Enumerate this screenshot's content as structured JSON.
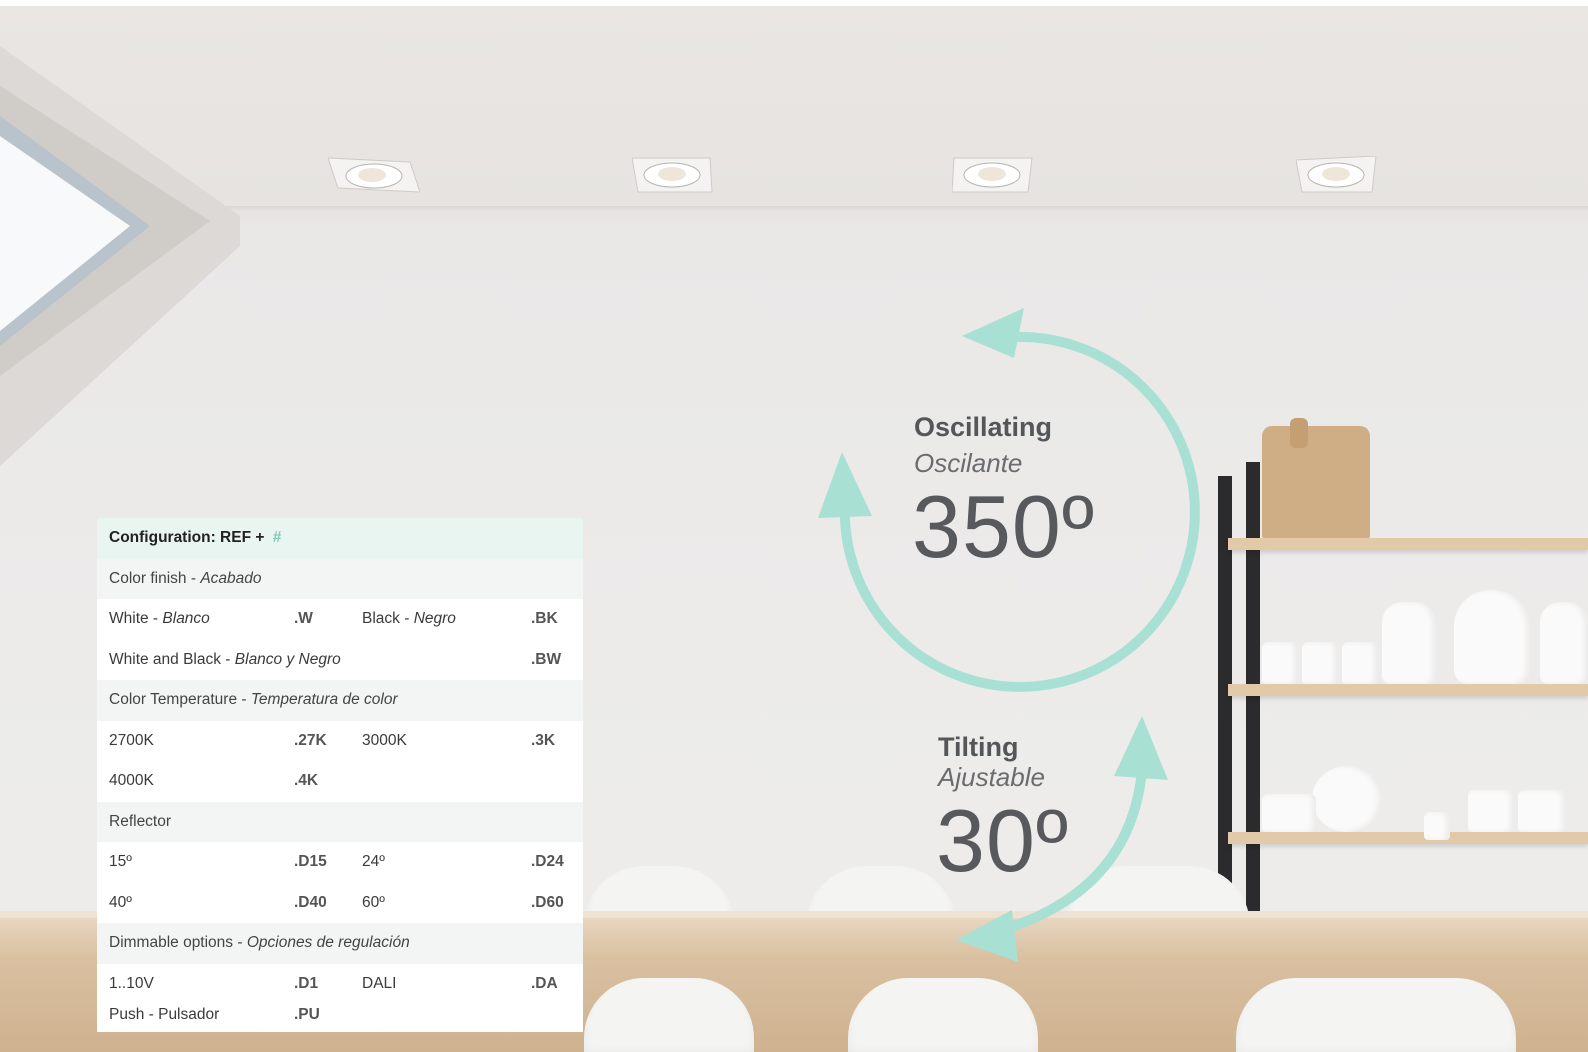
{
  "config": {
    "header_label": "Configuration: REF + ",
    "header_hash": "#",
    "sections": {
      "finish": {
        "title": "Color finish - ",
        "title_it": "Acabado"
      },
      "temperature": {
        "title": "Color Temperature - ",
        "title_it": "Temperatura de color"
      },
      "reflector": {
        "title": "Reflector"
      },
      "dimmable": {
        "title": "Dimmable options - ",
        "title_it": "Opciones de regulación"
      }
    },
    "rows": {
      "white": {
        "name": "White - ",
        "name_it": "Blanco",
        "code": ".W"
      },
      "black": {
        "name": "Black - ",
        "name_it": "Negro",
        "code": ".BK"
      },
      "white_black": {
        "name": "White and Black - ",
        "name_it": "Blanco y Negro",
        "code": ".BW"
      },
      "t2700": {
        "name": "2700K",
        "code": ".27K"
      },
      "t3000": {
        "name": "3000K",
        "code": ".3K"
      },
      "t4000": {
        "name": "4000K",
        "code": ".4K"
      },
      "r15": {
        "name": "15º",
        "code": ".D15"
      },
      "r24": {
        "name": "24º",
        "code": ".D24"
      },
      "r40": {
        "name": "40º",
        "code": ".D40"
      },
      "r60": {
        "name": "60º",
        "code": ".D60"
      },
      "d110": {
        "name": "1..10V",
        "code": ".D1"
      },
      "dali": {
        "name": "DALI",
        "code": ".DA"
      },
      "push": {
        "name": "Push - Pulsador",
        "code": ".PU"
      }
    }
  },
  "oscillating": {
    "title": "Oscillating",
    "subtitle": "Oscilante",
    "value": "350º"
  },
  "tilting": {
    "title": "Tilting",
    "subtitle": "Ajustable",
    "value": "30º"
  },
  "colors": {
    "accent": "#a8e0d4",
    "text": "#58595c"
  }
}
